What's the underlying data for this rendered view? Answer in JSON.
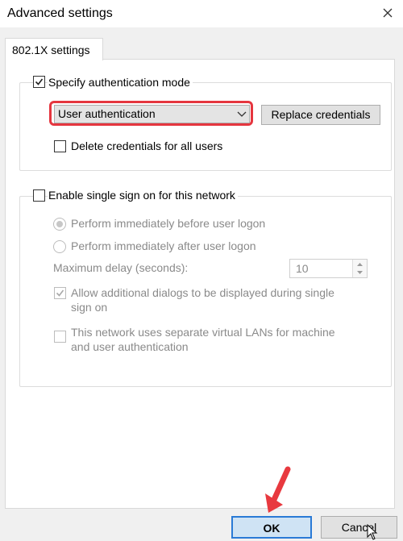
{
  "window": {
    "title": "Advanced settings"
  },
  "tab": {
    "label": "802.1X settings"
  },
  "auth_group": {
    "specify_mode_label": "Specify authentication mode",
    "specify_mode_checked": true,
    "mode_select": {
      "selected": "User authentication"
    },
    "replace_credentials_label": "Replace credentials",
    "delete_credentials_label": "Delete credentials for all users",
    "delete_credentials_checked": false
  },
  "sso_group": {
    "enable_sso_label": "Enable single sign on for this network",
    "enable_sso_checked": false,
    "radio_before_label": "Perform immediately before user logon",
    "radio_after_label": "Perform immediately after user logon",
    "max_delay_label": "Maximum delay (seconds):",
    "max_delay_value": "10",
    "allow_dialogs_label_line1": "Allow additional dialogs to be displayed during single",
    "allow_dialogs_label_line2": "sign on",
    "allow_dialogs_checked": true,
    "separate_vlans_label_line1": "This network uses separate virtual LANs for machine",
    "separate_vlans_label_line2": "and user authentication",
    "separate_vlans_checked": false
  },
  "buttons": {
    "ok": "OK",
    "cancel": "Cancel"
  },
  "annotation": {
    "arrow_color": "#e8393f",
    "highlight_color": "#e5363f"
  }
}
